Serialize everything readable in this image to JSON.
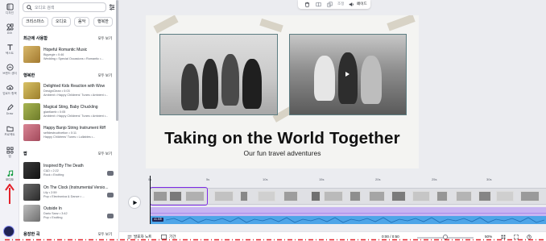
{
  "rail": {
    "items": [
      {
        "label": "디자인"
      },
      {
        "label": "요소"
      },
      {
        "label": "텍스트"
      },
      {
        "label": "브랜드 센터"
      },
      {
        "label": "업로드 항목"
      },
      {
        "label": "그리기"
      },
      {
        "label": "Draw"
      },
      {
        "label": "프로젝트"
      },
      {
        "label": "앱"
      },
      {
        "label": "오디오"
      }
    ]
  },
  "panel": {
    "search_placeholder": "오디오 검색",
    "chips": [
      "크리스마스",
      "오디오",
      "음악",
      "행복한"
    ],
    "sections": [
      {
        "title": "최근에 사용함",
        "see_all": "모두 보기",
        "tracks": [
          {
            "title": "Hopeful Romantic Music",
            "meta": "Bigvegie • 0:46",
            "tags": "Wedding • Special Occasions • Romantic •...",
            "color": "#c9a04f"
          }
        ]
      },
      {
        "title": "행복한",
        "see_all": "모두 보기",
        "tracks": [
          {
            "title": "Delighted Kids Reaction with Wow",
            "meta": "DesignClean • 0:03",
            "tags": "Ambient • Happy Childrens' Tunes • Ambient •...",
            "color": "#b99b3d"
          },
          {
            "title": "Magical Sting, Baby Chuckling",
            "meta": "giantlamb • 0:05",
            "tags": "Ambient • Happy Childrens' Tunes • Ambient •...",
            "color": "#8c9c3a"
          },
          {
            "title": "Happy Banjo String Instrument Riff",
            "meta": "selfdestructivetion • 0:11",
            "tags": "Happy Childrens' Tunes • Lullabies •...",
            "color": "#c56a7b"
          }
        ]
      },
      {
        "title": "팝",
        "see_all": "모두 보기",
        "tracks": [
          {
            "title": "Inspired By The Death",
            "meta": "C&D • 2:22",
            "tags": "Rock • Exciting",
            "color": "#2b2b2b"
          },
          {
            "title": "On The Clock (Instrumental Versio...",
            "meta": "Lily • 2:59",
            "tags": "Pop • Electronica & Dance • ...",
            "color": "#505050"
          },
          {
            "title": "Outside In",
            "meta": "Dario Sanz • 3:42",
            "tags": "Pop • Exciting",
            "color": "#8a8a8a"
          }
        ]
      },
      {
        "title": "용장한 곡",
        "see_all": "모두 보기",
        "tracks": []
      }
    ]
  },
  "toolbar": {
    "items": [
      "조정",
      "페이드"
    ]
  },
  "slide": {
    "title": "Taking on the World Together",
    "subtitle": "Our fun travel adventures"
  },
  "timeline": {
    "ruler": [
      "0s",
      "5s",
      "10s",
      "15s",
      "20s",
      "25s",
      "30s",
      "35s",
      "40s",
      "45s"
    ],
    "audio_label": "41.5초"
  },
  "status": {
    "notes": "발표자 노트",
    "duration": "기간",
    "time": "0:00 / 0:50",
    "zoom": "50%"
  },
  "colors": {
    "accent": "#7d2ae8",
    "audio_purple": "#c8b4f2",
    "audio_blue": "#4ea5e8",
    "annotation": "#e3222b"
  }
}
